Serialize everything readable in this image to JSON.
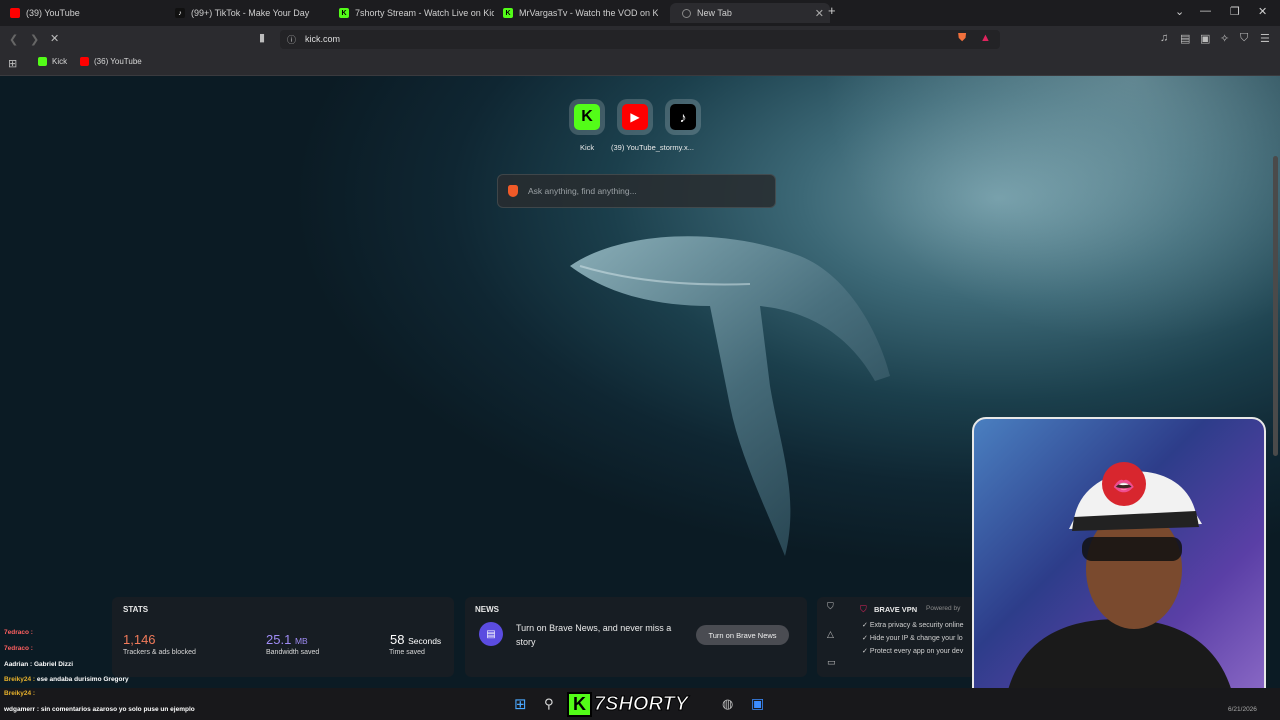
{
  "tabs": [
    {
      "label": "(39) YouTube",
      "color": "#ff0000"
    },
    {
      "label": "(99+) TikTok - Make Your Day",
      "color": "#ffffff"
    },
    {
      "label": "7shorty Stream - Watch Live on Kick",
      "color": "#53fc18"
    },
    {
      "label": "MrVargasTv - Watch the VOD on Kick",
      "color": "#53fc18"
    },
    {
      "label": "New Tab",
      "color": "#888888"
    }
  ],
  "window_controls": {
    "minimize": "—",
    "maximize": "❐",
    "close": "✕",
    "new_tab": "+",
    "chevron": "⌄"
  },
  "address_bar": {
    "url": "kick.com"
  },
  "bookmarks": [
    {
      "label": "Kick",
      "color": "#53fc18"
    },
    {
      "label": "(36) YouTube",
      "color": "#ff0000"
    }
  ],
  "top_sites": [
    {
      "label": "Kick",
      "glyph": "K",
      "bg": "#53fc18",
      "fg": "#000000"
    },
    {
      "label": "(39) YouTube_stormy.x...",
      "glyph": "▶",
      "bg": "#ff0000",
      "fg": "#ffffff"
    },
    {
      "label": "",
      "glyph": "♪",
      "bg": "#000000",
      "fg": "#ffffff"
    }
  ],
  "search": {
    "placeholder": "Ask anything, find anything..."
  },
  "stats": {
    "title": "STATS",
    "trackers": {
      "value": "1,146",
      "label": "Trackers & ads blocked",
      "color": "#f07a5a"
    },
    "bandwidth": {
      "value": "25.1",
      "unit": "MB",
      "label": "Bandwidth saved",
      "color": "#9f8cf5"
    },
    "time": {
      "value": "58",
      "unit": "Seconds",
      "label": "Time saved",
      "color": "#ffffff"
    }
  },
  "news": {
    "title": "NEWS",
    "text": "Turn on Brave News, and never miss a story",
    "button": "Turn on Brave News"
  },
  "vpn": {
    "title": "BRAVE VPN",
    "powered": "Powered by",
    "lines": [
      "Extra privacy & security online",
      "Hide your IP & change your lo",
      "Protect every app on your dev"
    ]
  },
  "chat": [
    {
      "user": "7edraco :",
      "msg": ""
    },
    {
      "user": "7edraco :",
      "msg": ""
    },
    {
      "user": "Aadrian :",
      "msg": "Gabriel Dizzi"
    },
    {
      "user": "Breiky24 :",
      "msg": "ese andaba durisimo Gregory"
    },
    {
      "user": "Breiky24 :",
      "msg": ""
    },
    {
      "user": "wdgamerr :",
      "msg": "sin comentarios azaroso   yo solo puse un ejemplo"
    }
  ],
  "taskbar": {
    "brand": "7SHORTY",
    "date": "6/21/2026"
  }
}
